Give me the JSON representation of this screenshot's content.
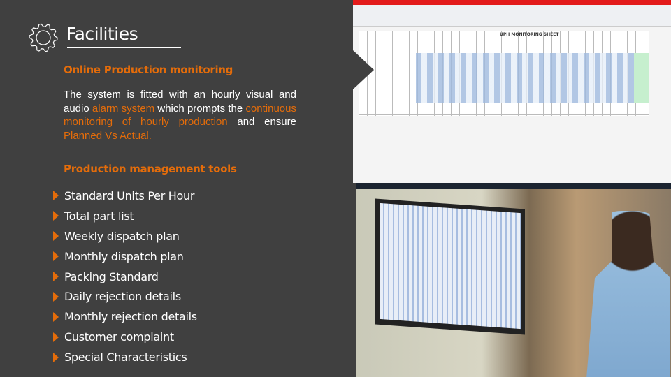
{
  "slide": {
    "title": "Facilities",
    "icon": "gear-icon",
    "section1": {
      "heading": "Online Production monitoring",
      "paragraph": [
        {
          "text": "The system is fitted with an hourly visual and audio ",
          "highlight": false
        },
        {
          "text": "alarm system",
          "highlight": true
        },
        {
          "text": " which prompts the ",
          "highlight": false
        },
        {
          "text": "continuous monitoring of hourly production",
          "highlight": true
        },
        {
          "text": " and ensure ",
          "highlight": false
        },
        {
          "text": "Planned Vs Actual.",
          "highlight": true
        }
      ]
    },
    "section2": {
      "heading": "Production management tools",
      "items": [
        "Standard Units Per Hour",
        "Total part list",
        "Weekly dispatch plan",
        "Monthly dispatch plan",
        "Packing Standard",
        "Daily rejection details",
        "Monthly rejection details",
        "Customer complaint",
        "Special Characteristics"
      ]
    },
    "screenshot": {
      "sheet_title": "UPH MONITORING SHEET"
    },
    "colors": {
      "background": "#404040",
      "accent": "#e46c0a",
      "text": "#ffffff"
    }
  }
}
